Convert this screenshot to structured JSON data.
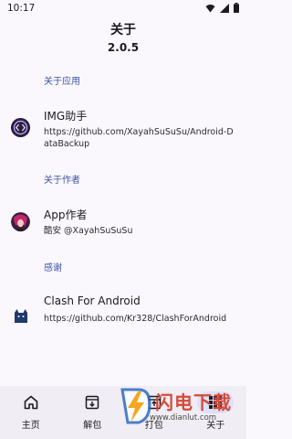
{
  "status_bar": {
    "time": "10:17"
  },
  "header": {
    "title": "关于",
    "version": "2.0.5"
  },
  "sections": {
    "app": {
      "header": "关于应用",
      "title": "IMG助手",
      "subtitle": "https://github.com/XayahSuSuSu/Android-DataBackup"
    },
    "author": {
      "header": "关于作者",
      "title": "App作者",
      "subtitle": "酷安 @XayahSuSuSu"
    },
    "thanks": {
      "header": "感谢",
      "title": "Clash For Android",
      "subtitle": "https://github.com/Kr328/ClashForAndroid"
    }
  },
  "nav": {
    "items": [
      {
        "label": "主页",
        "icon": "home-icon"
      },
      {
        "label": "解包",
        "icon": "unpack-icon"
      },
      {
        "label": "打包",
        "icon": "pack-icon"
      },
      {
        "label": "关于",
        "icon": "grid-icon"
      }
    ],
    "active_index": 3
  },
  "watermark": {
    "text": "闪电下载",
    "url": "www.dianlut.com"
  },
  "colors": {
    "accent": "#3d55a3",
    "nav_bg": "#f1edf4",
    "page_bg": "#fbf8fd"
  }
}
